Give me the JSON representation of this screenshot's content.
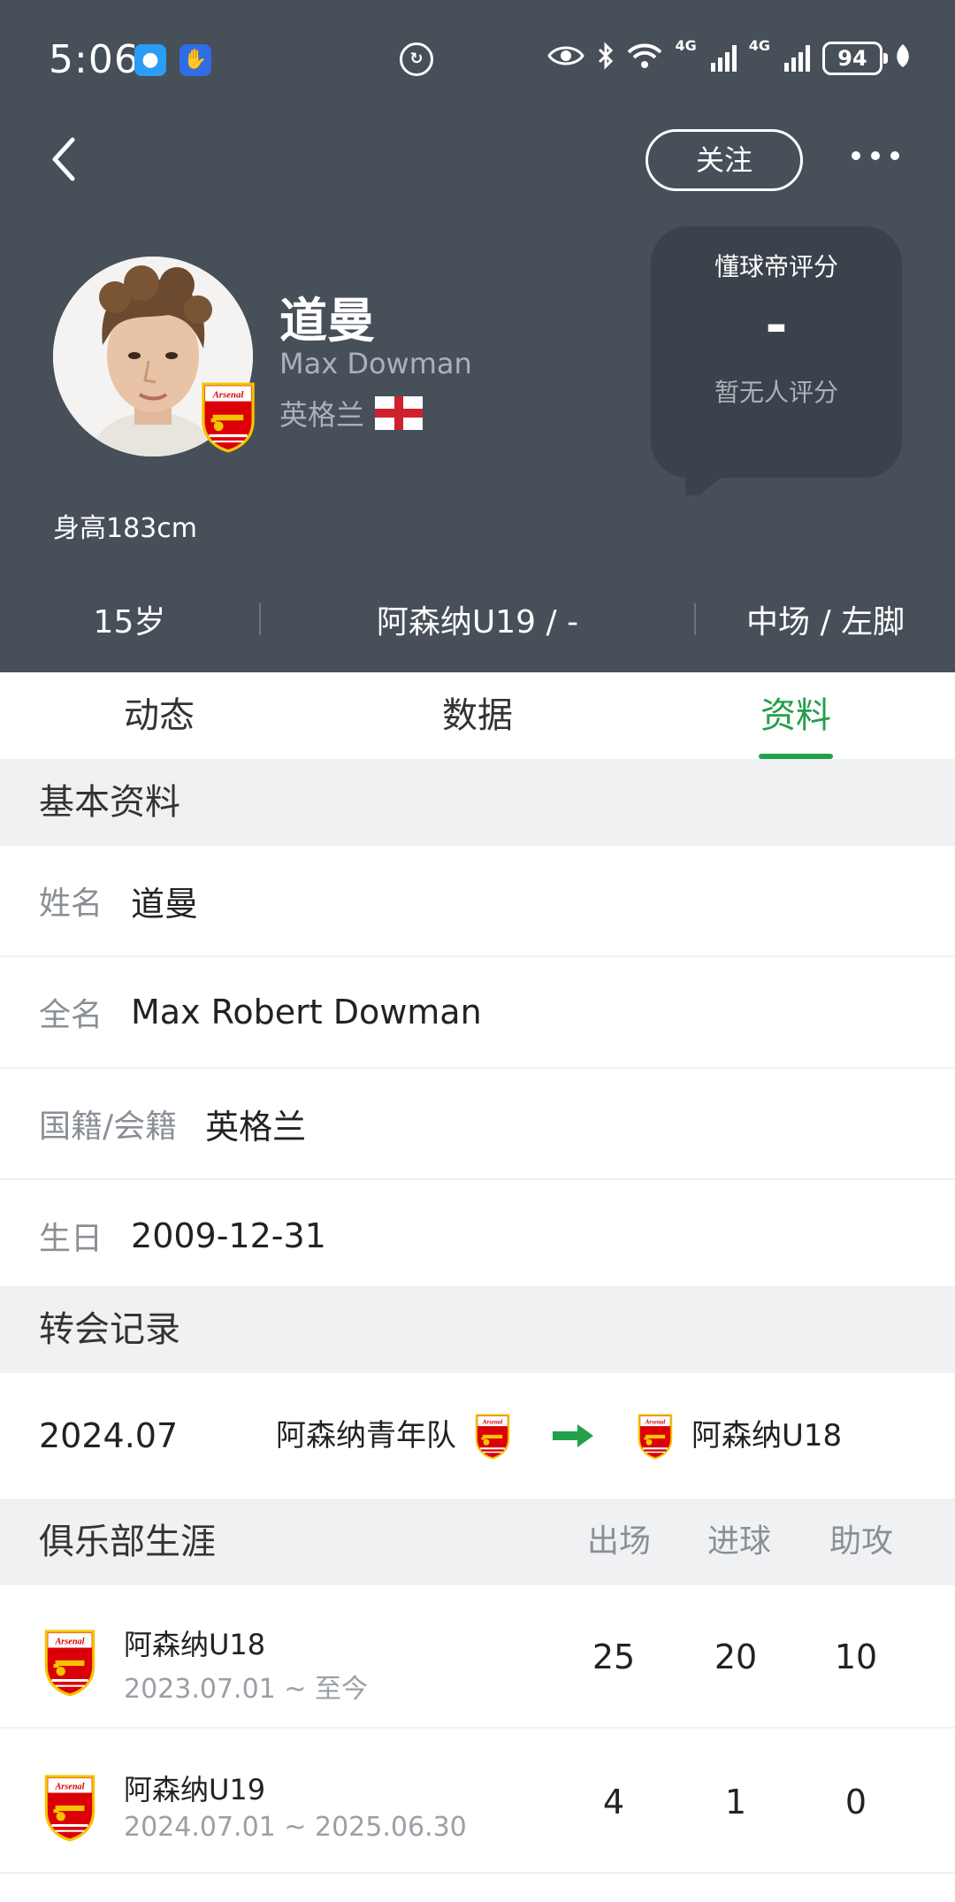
{
  "status_bar": {
    "time": "5:06",
    "battery": "94",
    "net1": "4G",
    "net2": "4G"
  },
  "header": {
    "follow_label": "关注",
    "more_label": "···",
    "name_cn": "道曼",
    "name_en": "Max Dowman",
    "country": "英格兰",
    "rating_title": "懂球帝评分",
    "rating_value": "-",
    "rating_note": "暂无人评分",
    "height": "身高183cm",
    "age": "15岁",
    "club": "阿森纳U19 / -",
    "position": "中场 / 左脚"
  },
  "tabs": [
    {
      "label": "动态",
      "active": false
    },
    {
      "label": "数据",
      "active": false
    },
    {
      "label": "资料",
      "active": true
    }
  ],
  "basic_info": {
    "title": "基本资料",
    "rows": [
      {
        "key": "姓名",
        "value": "道曼"
      },
      {
        "key": "全名",
        "value": "Max Robert Dowman"
      },
      {
        "key": "国籍/会籍",
        "value": "英格兰"
      },
      {
        "key": "生日",
        "value": "2009-12-31"
      }
    ]
  },
  "transfers": {
    "title": "转会记录",
    "items": [
      {
        "date": "2024.07",
        "from": "阿森纳青年队",
        "to": "阿森纳U18"
      }
    ]
  },
  "career": {
    "title": "俱乐部生涯",
    "columns": [
      "出场",
      "进球",
      "助攻"
    ],
    "rows": [
      {
        "club": "阿森纳U18",
        "period": "2023.07.01 ~ 至今",
        "apps": "25",
        "goals": "20",
        "assists": "10"
      },
      {
        "club": "阿森纳U19",
        "period": "2024.07.01 ~ 2025.06.30",
        "apps": "4",
        "goals": "1",
        "assists": "0"
      }
    ]
  },
  "colors": {
    "header_bg": "#474f59",
    "accent": "#22a04a",
    "arsenal_red": "#db0007"
  }
}
